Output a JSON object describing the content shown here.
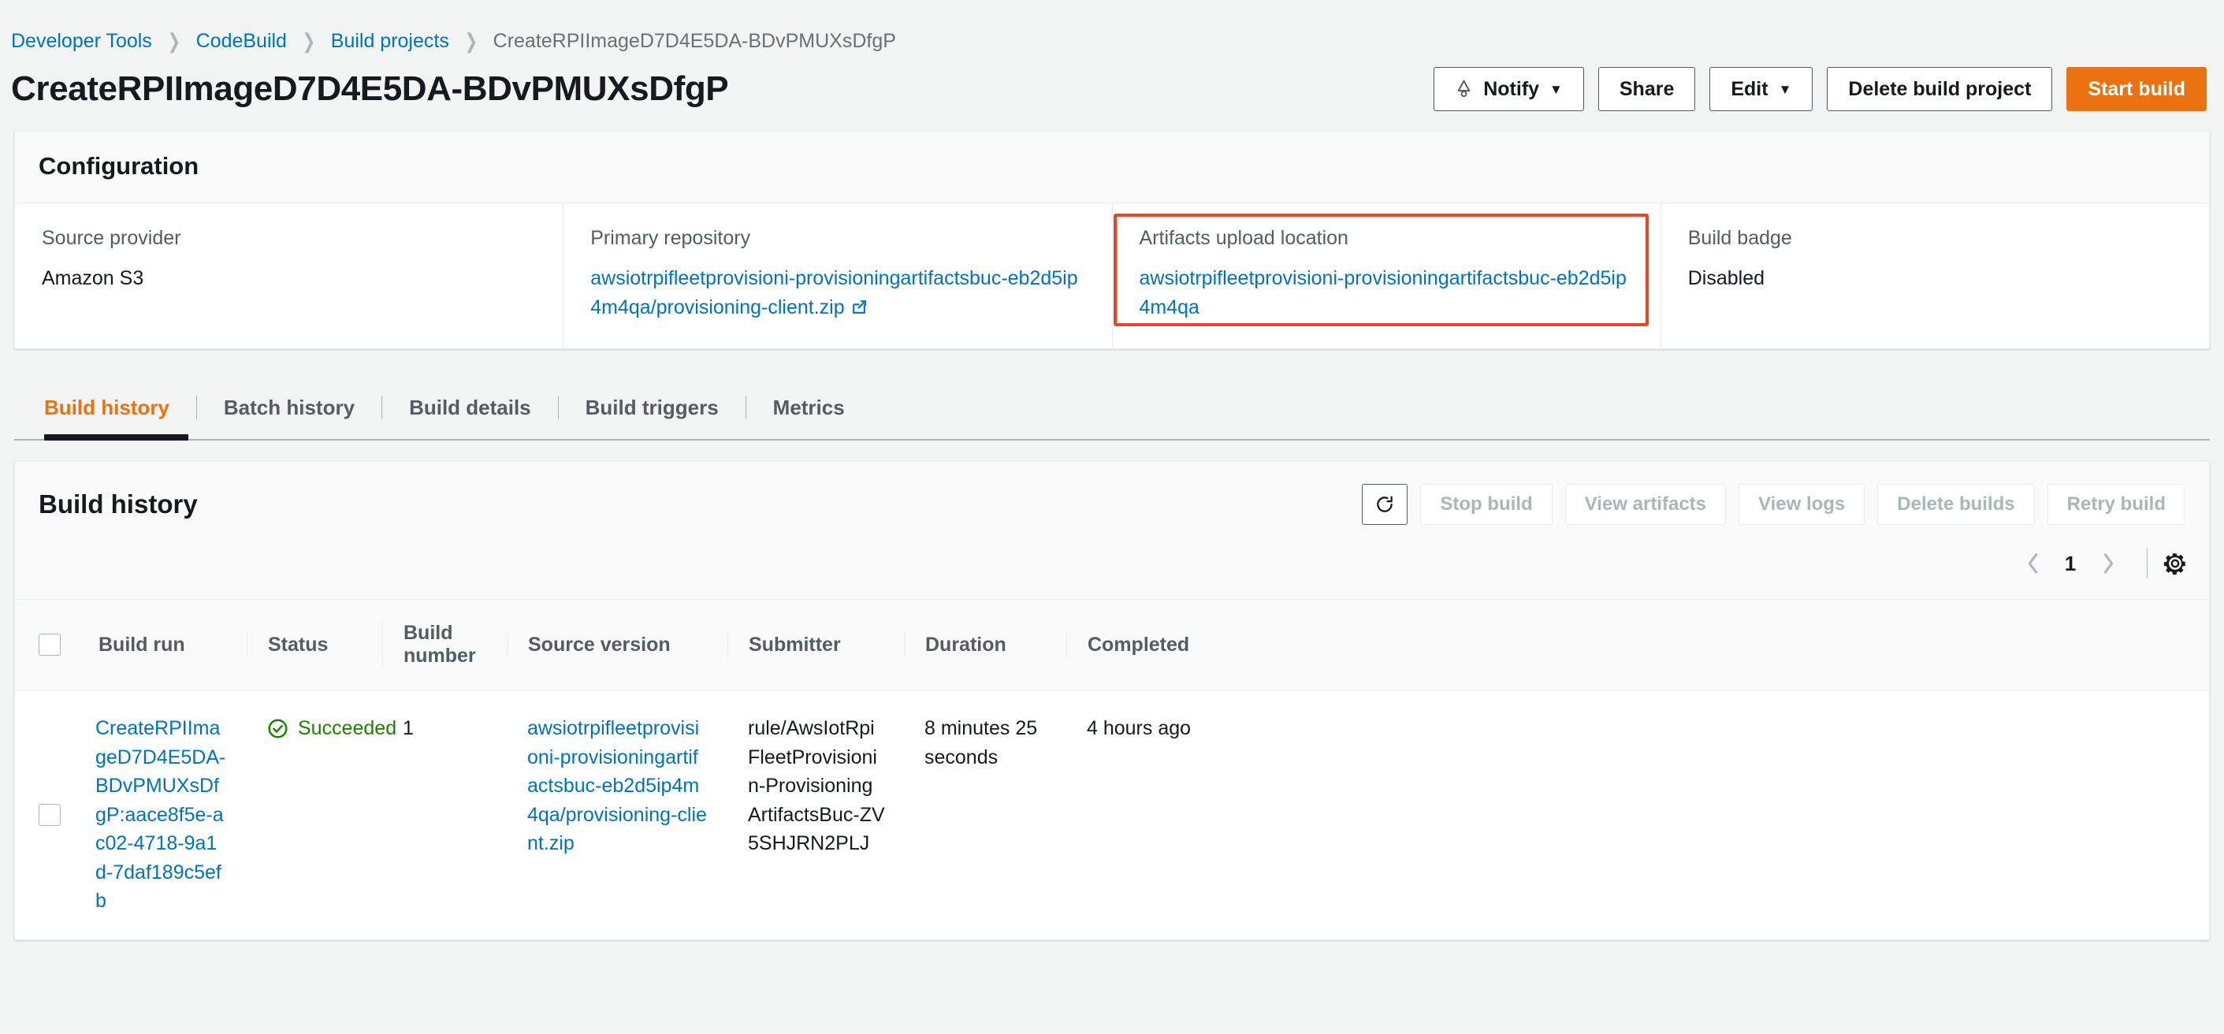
{
  "breadcrumb": {
    "items": [
      {
        "label": "Developer Tools",
        "type": "link"
      },
      {
        "label": "CodeBuild",
        "type": "link"
      },
      {
        "label": "Build projects",
        "type": "link"
      },
      {
        "label": "CreateRPIImageD7D4E5DA-BDvPMUXsDfgP",
        "type": "current"
      }
    ],
    "separator": "❯"
  },
  "header": {
    "title": "CreateRPIImageD7D4E5DA-BDvPMUXsDfgP",
    "actions": {
      "notify": {
        "label": "Notify",
        "icon": "bell-icon",
        "caret": "▼"
      },
      "share": {
        "label": "Share"
      },
      "edit": {
        "label": "Edit",
        "caret": "▼"
      },
      "delete": {
        "label": "Delete build project"
      },
      "start": {
        "label": "Start build",
        "color": "#ec7211"
      }
    }
  },
  "configuration": {
    "heading": "Configuration",
    "columns": [
      {
        "label": "Source provider",
        "value": "Amazon S3",
        "is_link": false,
        "external": false,
        "highlighted": false
      },
      {
        "label": "Primary repository",
        "value": "awsiotrpifleetprovisioni-provisioningartifactsbuc-eb2d5ip4m4qa/provisioning-client.zip",
        "is_link": true,
        "external": true,
        "highlighted": false
      },
      {
        "label": "Artifacts upload location",
        "value": "awsiotrpifleetprovisioni-provisioningartifactsbuc-eb2d5ip4m4qa",
        "is_link": true,
        "external": false,
        "highlighted": true,
        "highlight_color": "#ef4424"
      },
      {
        "label": "Build badge",
        "value": "Disabled",
        "is_link": false,
        "external": false,
        "highlighted": false
      }
    ]
  },
  "tabs": {
    "items": [
      {
        "label": "Build history",
        "active": true
      },
      {
        "label": "Batch history",
        "active": false
      },
      {
        "label": "Build details",
        "active": false
      },
      {
        "label": "Build triggers",
        "active": false
      },
      {
        "label": "Metrics",
        "active": false
      }
    ],
    "active_color": "#ec7211"
  },
  "build_history": {
    "heading": "Build history",
    "toolbar": {
      "refresh_icon": "refresh-icon",
      "buttons": [
        {
          "label": "Stop build",
          "disabled": true
        },
        {
          "label": "View artifacts",
          "disabled": true
        },
        {
          "label": "View logs",
          "disabled": true
        },
        {
          "label": "Delete builds",
          "disabled": true
        },
        {
          "label": "Retry build",
          "disabled": true
        }
      ]
    },
    "pagination": {
      "prev_icon": "chevron-left-icon",
      "page": "1",
      "next_icon": "chevron-right-icon",
      "settings_icon": "gear-icon"
    },
    "table": {
      "headers": [
        "Build run",
        "Status",
        "Build number",
        "Source version",
        "Submitter",
        "Duration",
        "Completed"
      ],
      "rows": [
        {
          "selected": false,
          "build_run": "CreateRPIImageD7D4E5DA-BDvPMUXsDfgP:aace8f5e-ac02-4718-9a1d-7daf189c5efb",
          "status": "Succeeded",
          "status_color": "#1d8102",
          "status_icon": "check-circle-icon",
          "build_number": "1",
          "source_version": "awsiotrpifleetprovisioni-provisioningartifactsbuc-eb2d5ip4m4qa/provisioning-client.zip",
          "submitter": "rule/AwsIotRpiFleetProvisionin-ProvisioningArtifactsBuc-ZV5SHJRN2PLJ",
          "duration": "8 minutes 25 seconds",
          "completed": "4 hours ago"
        }
      ]
    }
  }
}
